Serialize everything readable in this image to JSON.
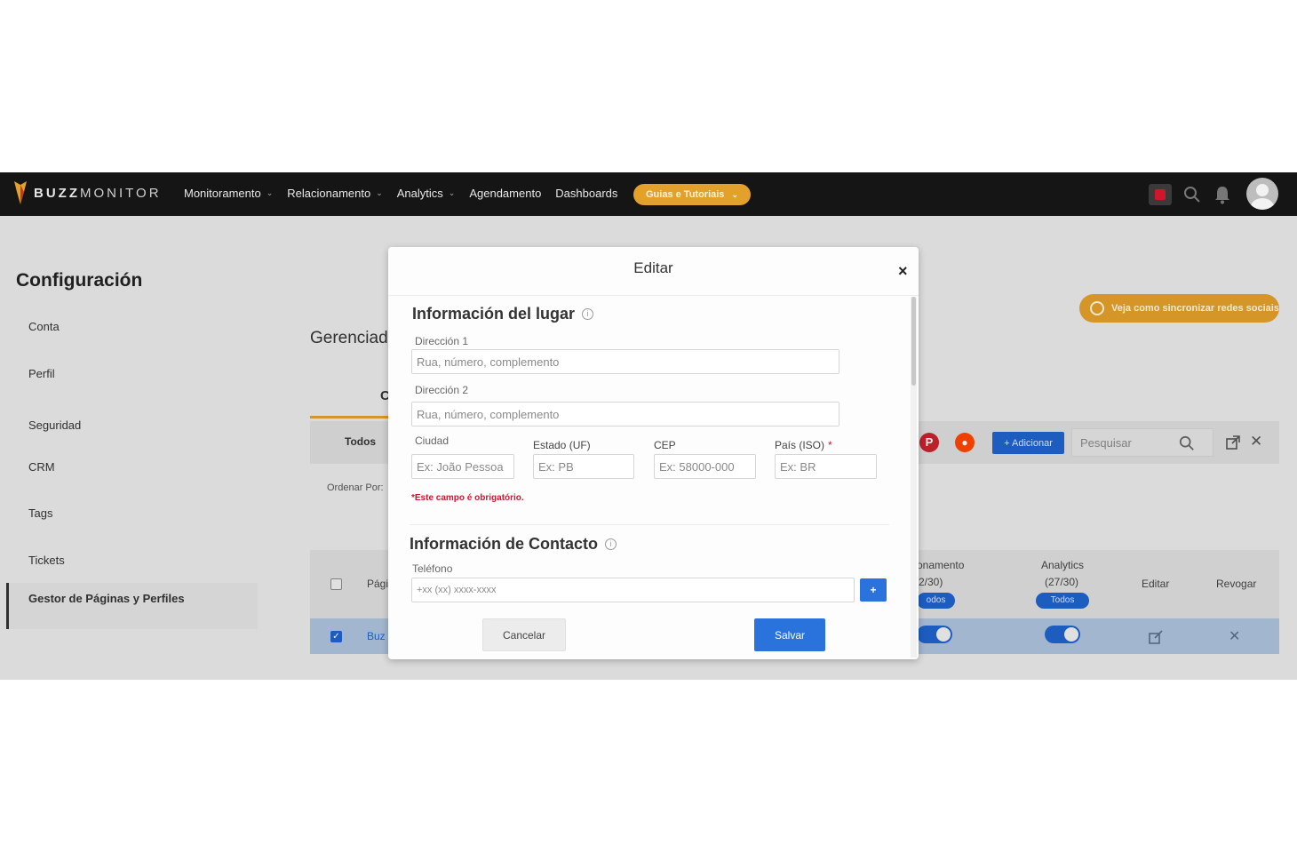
{
  "colors": {
    "nav_bg": "#151515",
    "accent_orange": "#e3a02a",
    "primary_blue": "#2a73dc",
    "error_red": "#d0162b"
  },
  "topnav": {
    "logo_bold": "BUZZ",
    "logo_light": "MONITOR",
    "items": [
      {
        "label": "Monitoramento",
        "has_dropdown": true
      },
      {
        "label": "Relacionamento",
        "has_dropdown": true
      },
      {
        "label": "Analytics",
        "has_dropdown": true
      },
      {
        "label": "Agendamento",
        "has_dropdown": false
      },
      {
        "label": "Dashboards",
        "has_dropdown": false
      }
    ],
    "guides_label": "Guias e Tutoriais",
    "icons": [
      "record-icon",
      "search-icon",
      "bell-icon",
      "avatar"
    ]
  },
  "sidebar": {
    "title": "Configuración",
    "items": [
      {
        "label": "Conta"
      },
      {
        "label": "Perfil"
      },
      {
        "label": "Seguridad"
      },
      {
        "label": "CRM"
      },
      {
        "label": "Tags"
      },
      {
        "label": "Tickets"
      },
      {
        "label": "Gestor de Páginas y Perfiles",
        "active": true
      }
    ]
  },
  "main": {
    "title": "Gerenciad",
    "sync_label": "Veja como sincronizar redes sociais",
    "tab_partial": "C",
    "filter_todos": "Todos",
    "add_label": "+ Adicionar",
    "search_placeholder": "Pesquisar",
    "order_label": "Ordenar Por:",
    "table": {
      "col_page": "Pági",
      "col_rel_title": "onamento",
      "col_rel_count": "2/30)",
      "col_rel_pill": "odos",
      "col_analytics_title": "Analytics",
      "col_analytics_count": "(27/30)",
      "col_analytics_pill": "Todos",
      "col_edit": "Editar",
      "col_revoke": "Revogar",
      "row_link": "Buz"
    }
  },
  "modal": {
    "title": "Editar",
    "close": "×",
    "section_place": {
      "title": "Información del lugar",
      "address1_label": "Dirección 1",
      "address1_placeholder": "Rua, número, complemento",
      "address1_value": "",
      "address2_label": "Dirección 2",
      "address2_placeholder": "Rua, número, complemento",
      "address2_value": "",
      "city_label": "Ciudad",
      "city_placeholder": "Ex: João Pessoa",
      "state_label": "Estado (UF)",
      "state_placeholder": "Ex: PB",
      "cep_label": "CEP",
      "cep_placeholder": "Ex: 58000-000",
      "country_label": "País (ISO)",
      "country_required": "*",
      "country_placeholder": "Ex: BR",
      "error": "*Este campo é obrigatório."
    },
    "section_contact": {
      "title": "Información de Contacto",
      "phone_label": "Teléfono",
      "phone_placeholder": "+xx (xx) xxxx-xxxx",
      "add_phone": "+"
    },
    "cancel_label": "Cancelar",
    "save_label": "Salvar"
  }
}
